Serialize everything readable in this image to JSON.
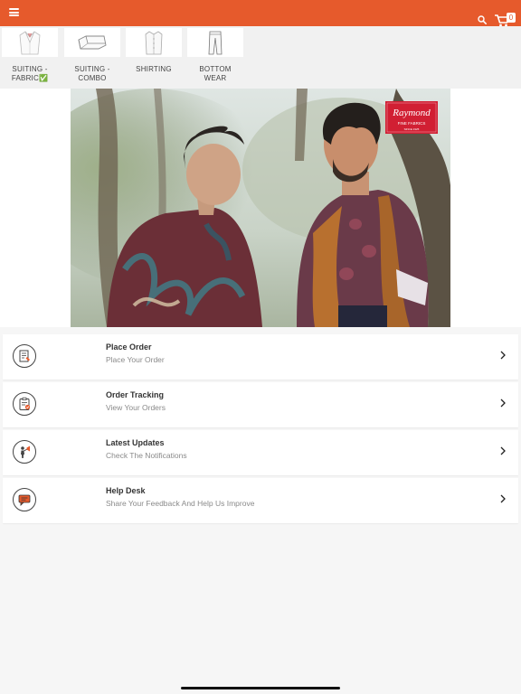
{
  "header": {
    "menu_icon": "hamburger-menu-icon",
    "search_icon": "search-icon",
    "cart_icon": "cart-icon",
    "cart_count": "0",
    "bar_color": "#e65a2c"
  },
  "categories": [
    {
      "label": "SUITING - FABRIC✅",
      "icon": "suit-jacket-icon"
    },
    {
      "label": "SUITING - COMBO",
      "icon": "folded-fabric-icon"
    },
    {
      "label": "SHIRTING",
      "icon": "shirt-icon"
    },
    {
      "label": "BOTTOM WEAR",
      "icon": "trousers-icon"
    }
  ],
  "banner": {
    "brand": "Raymond",
    "tagline": "FINE FABRICS",
    "since": "SINCE 1925"
  },
  "menu": [
    {
      "title": "Place Order",
      "subtitle": "Place Your Order",
      "icon": "order-form-icon"
    },
    {
      "title": "Order Tracking",
      "subtitle": "View Your Orders",
      "icon": "clipboard-check-icon"
    },
    {
      "title": "Latest Updates",
      "subtitle": "Check The Notifications",
      "icon": "announcement-icon"
    },
    {
      "title": "Help Desk",
      "subtitle": "Share Your Feedback And Help Us Improve",
      "icon": "chat-bubble-icon"
    }
  ],
  "accent_color": "#e65a2c"
}
